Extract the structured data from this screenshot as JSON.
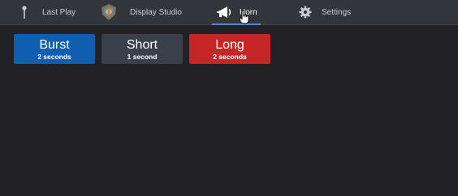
{
  "nav": {
    "items": [
      {
        "label": "Last Play",
        "icon": "pin-icon"
      },
      {
        "label": "Display Studio",
        "icon": "display-studio-logo-icon"
      },
      {
        "label": "Horn",
        "icon": "megaphone-icon",
        "active": true
      },
      {
        "label": "Settings",
        "icon": "gear-icon"
      }
    ]
  },
  "horn_buttons": [
    {
      "title": "Burst",
      "subtitle": "2 seconds",
      "color": "#0f5eb2"
    },
    {
      "title": "Short",
      "subtitle": "1 second",
      "color": "#3a404a"
    },
    {
      "title": "Long",
      "subtitle": "2 seconds",
      "color": "#c72627"
    }
  ],
  "colors": {
    "background": "#222226",
    "topbar": "#32353c",
    "active_underline": "#5c86c6"
  }
}
